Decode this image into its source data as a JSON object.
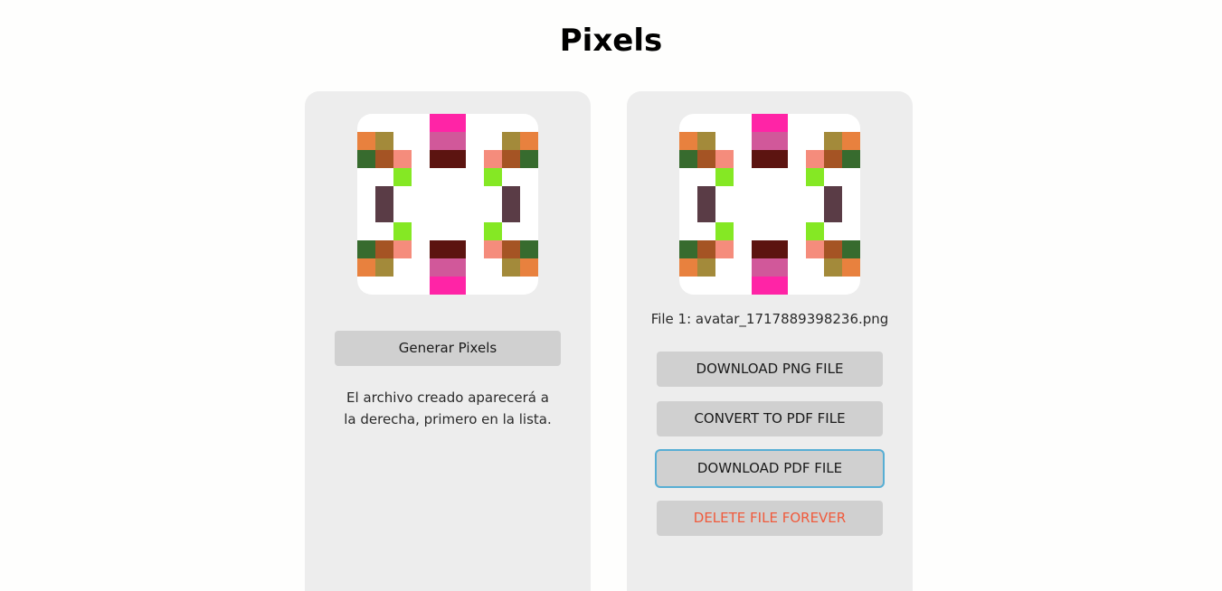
{
  "header": {
    "title": "Pixels"
  },
  "avatar_pattern": {
    "grid_cols": 10,
    "grid_rows": 10,
    "colors": {
      "magenta": "#ff24a6",
      "rose": "#d1589a",
      "maroon": "#5c1410",
      "orange": "#e8813e",
      "olive": "#a38a3a",
      "green": "#376b2e",
      "rust": "#a55424",
      "salmon": "#f58c7c",
      "lime": "#85e824",
      "plum": "#5a3c46"
    },
    "cells": [
      [
        4,
        0,
        "magenta"
      ],
      [
        5,
        0,
        "magenta"
      ],
      [
        0,
        1,
        "orange"
      ],
      [
        1,
        1,
        "olive"
      ],
      [
        4,
        1,
        "rose"
      ],
      [
        5,
        1,
        "rose"
      ],
      [
        8,
        1,
        "olive"
      ],
      [
        9,
        1,
        "orange"
      ],
      [
        0,
        2,
        "green"
      ],
      [
        1,
        2,
        "rust"
      ],
      [
        2,
        2,
        "salmon"
      ],
      [
        4,
        2,
        "maroon"
      ],
      [
        5,
        2,
        "maroon"
      ],
      [
        7,
        2,
        "salmon"
      ],
      [
        8,
        2,
        "rust"
      ],
      [
        9,
        2,
        "green"
      ],
      [
        2,
        3,
        "lime"
      ],
      [
        7,
        3,
        "lime"
      ],
      [
        1,
        4,
        "plum"
      ],
      [
        8,
        4,
        "plum"
      ],
      [
        1,
        5,
        "plum"
      ],
      [
        8,
        5,
        "plum"
      ],
      [
        2,
        6,
        "lime"
      ],
      [
        7,
        6,
        "lime"
      ],
      [
        0,
        7,
        "green"
      ],
      [
        1,
        7,
        "rust"
      ],
      [
        2,
        7,
        "salmon"
      ],
      [
        4,
        7,
        "maroon"
      ],
      [
        5,
        7,
        "maroon"
      ],
      [
        7,
        7,
        "salmon"
      ],
      [
        8,
        7,
        "rust"
      ],
      [
        9,
        7,
        "green"
      ],
      [
        0,
        8,
        "orange"
      ],
      [
        1,
        8,
        "olive"
      ],
      [
        4,
        8,
        "rose"
      ],
      [
        5,
        8,
        "rose"
      ],
      [
        8,
        8,
        "olive"
      ],
      [
        9,
        8,
        "orange"
      ],
      [
        4,
        9,
        "magenta"
      ],
      [
        5,
        9,
        "magenta"
      ]
    ]
  },
  "generator_panel": {
    "generate_button": "Generar Pixels",
    "help_text_line1": "El archivo creado aparecerá a",
    "help_text_line2": "la derecha, primero en la lista."
  },
  "files_panel": {
    "file_label": "File 1: avatar_1717889398236.png",
    "download_png_button": "DOWNLOAD PNG FILE",
    "convert_pdf_button": "CONVERT TO PDF FILE",
    "download_pdf_button": "DOWNLOAD PDF FILE",
    "delete_button": "DELETE FILE FOREVER"
  }
}
